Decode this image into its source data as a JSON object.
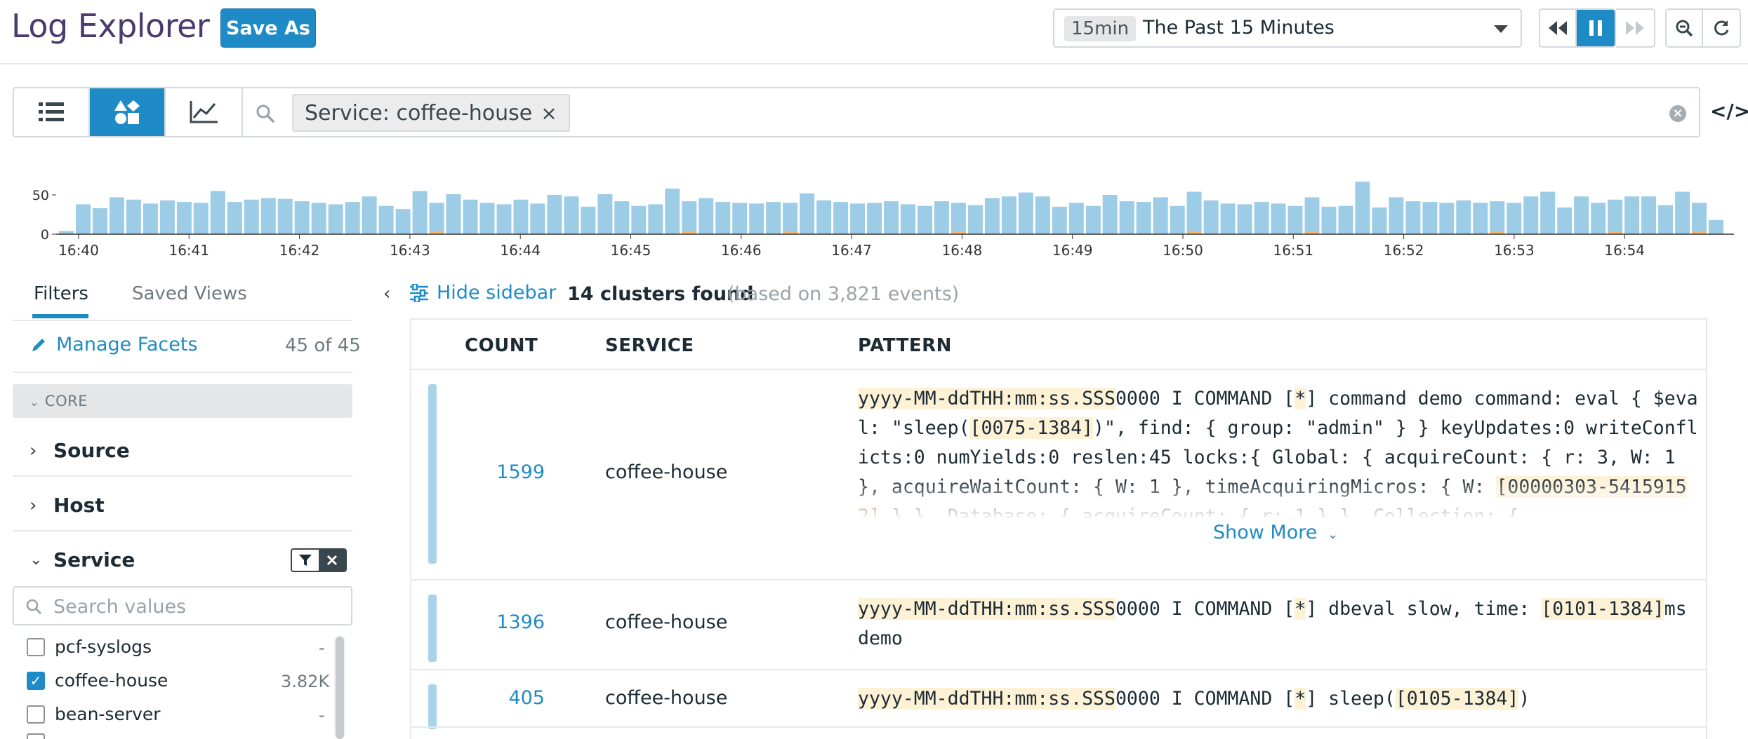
{
  "header": {
    "title": "Log Explorer",
    "save_as_label": "Save As",
    "time_chip": "15min",
    "time_label": "The Past 15 Minutes"
  },
  "search": {
    "tag_label": "Service: coffee-house",
    "tag_close": "×",
    "code_icon": "</>"
  },
  "chart_data": {
    "type": "bar",
    "y_ticks": [
      "50",
      "0"
    ],
    "ylim": [
      0,
      75
    ],
    "x_ticks": [
      "16:40",
      "16:41",
      "16:42",
      "16:43",
      "16:44",
      "16:45",
      "16:46",
      "16:47",
      "16:48",
      "16:49",
      "16:50",
      "16:51",
      "16:52",
      "16:53",
      "16:54"
    ],
    "series": [
      {
        "color": "#9ccce6",
        "values": [
          4,
          38,
          33,
          47,
          44,
          39,
          43,
          41,
          40,
          55,
          41,
          44,
          46,
          45,
          42,
          40,
          38,
          41,
          48,
          36,
          32,
          55,
          40,
          51,
          44,
          40,
          38,
          44,
          39,
          50,
          48,
          35,
          51,
          42,
          36,
          38,
          58,
          42,
          46,
          41,
          40,
          39,
          41,
          40,
          52,
          43,
          41,
          39,
          40,
          42,
          38,
          36,
          42,
          40,
          37,
          46,
          48,
          53,
          48,
          35,
          40,
          36,
          50,
          42,
          41,
          47,
          36,
          54,
          43,
          39,
          38,
          41,
          39,
          36,
          47,
          35,
          36,
          67,
          34,
          47,
          42,
          41,
          40,
          43,
          40,
          42,
          40,
          48,
          54,
          34,
          48,
          40,
          44,
          48,
          48,
          37,
          54,
          40,
          18
        ]
      },
      {
        "color": "#f4b971",
        "values": [
          0,
          0,
          0,
          0,
          0,
          0,
          0,
          0,
          0,
          0,
          0,
          0,
          0,
          0,
          0,
          0,
          0,
          0,
          0,
          0,
          0,
          0,
          3,
          0,
          0,
          0,
          0,
          0,
          0,
          0,
          0,
          0,
          0,
          0,
          0,
          0,
          0,
          3,
          0,
          0,
          0,
          0,
          0,
          3,
          0,
          0,
          0,
          0,
          0,
          0,
          0,
          0,
          0,
          3,
          0,
          0,
          0,
          0,
          0,
          0,
          0,
          0,
          0,
          0,
          0,
          0,
          0,
          3,
          0,
          0,
          0,
          0,
          0,
          0,
          3,
          0,
          0,
          0,
          0,
          0,
          0,
          0,
          0,
          0,
          0,
          3,
          0,
          0,
          0,
          0,
          0,
          0,
          3,
          0,
          0,
          0,
          0,
          3,
          0
        ]
      }
    ]
  },
  "sidebar": {
    "tab_filters": "Filters",
    "tab_saved_views": "Saved Views",
    "manage_facets": "Manage Facets",
    "facet_count": "45 of 45",
    "core_label": "CORE",
    "facets": [
      "Source",
      "Host",
      "Service"
    ],
    "search_values_placeholder": "Search values",
    "values": [
      {
        "name": "pcf-syslogs",
        "count": "-",
        "checked": false
      },
      {
        "name": "coffee-house",
        "count": "3.82K",
        "checked": true
      },
      {
        "name": "bean-server",
        "count": "-",
        "checked": false
      }
    ]
  },
  "main": {
    "hide_sidebar": "Hide sidebar",
    "clusters_found": "14 clusters found",
    "clusters_sub": "(based on 3,821 events)",
    "columns": [
      "COUNT",
      "SERVICE",
      "PATTERN"
    ],
    "show_more": "Show More",
    "rows": [
      {
        "count": "1599",
        "service": "coffee-house",
        "bar_fraction": 1.0,
        "pattern": [
          {
            "t": "yyyy-MM-ddTHH:mm:ss.SSS",
            "h": true
          },
          {
            "t": "0000 I COMMAND [",
            "h": false
          },
          {
            "t": "*",
            "h": true
          },
          {
            "t": "] command demo command: eval { $eval: \"sleep(",
            "h": false
          },
          {
            "t": "[0075-1384]",
            "h": true
          },
          {
            "t": ")\", find: { group: \"admin\" } } keyUpdates:0 writeConflicts:0 numYields:0 reslen:45 locks:{ Global: { acquireCount: { r: 3, W: 1 }, acquireWaitCount: { W: 1 }, timeAcquiringMicros: { W: ",
            "h": false
          },
          {
            "t": "[00000303-54159152]",
            "h": true
          },
          {
            "t": " } }, Database: { acquireCount: { r: 1 } }, Collection: {",
            "h": false
          }
        ]
      },
      {
        "count": "1396",
        "service": "coffee-house",
        "bar_fraction": 0.87,
        "pattern": [
          {
            "t": "yyyy-MM-ddTHH:mm:ss.SSS",
            "h": true
          },
          {
            "t": "0000 I COMMAND [",
            "h": false
          },
          {
            "t": "*",
            "h": true
          },
          {
            "t": "] dbeval slow, time: ",
            "h": false
          },
          {
            "t": "[0101-1384]",
            "h": true
          },
          {
            "t": "ms demo",
            "h": false
          }
        ]
      },
      {
        "count": "405",
        "service": "coffee-house",
        "bar_fraction": 0.25,
        "pattern": [
          {
            "t": "yyyy-MM-ddTHH:mm:ss.SSS",
            "h": true
          },
          {
            "t": "0000 I COMMAND [",
            "h": false
          },
          {
            "t": "*",
            "h": true
          },
          {
            "t": "] sleep(",
            "h": false
          },
          {
            "t": "[0105-1384]",
            "h": true
          },
          {
            "t": ")",
            "h": false
          }
        ]
      }
    ]
  }
}
